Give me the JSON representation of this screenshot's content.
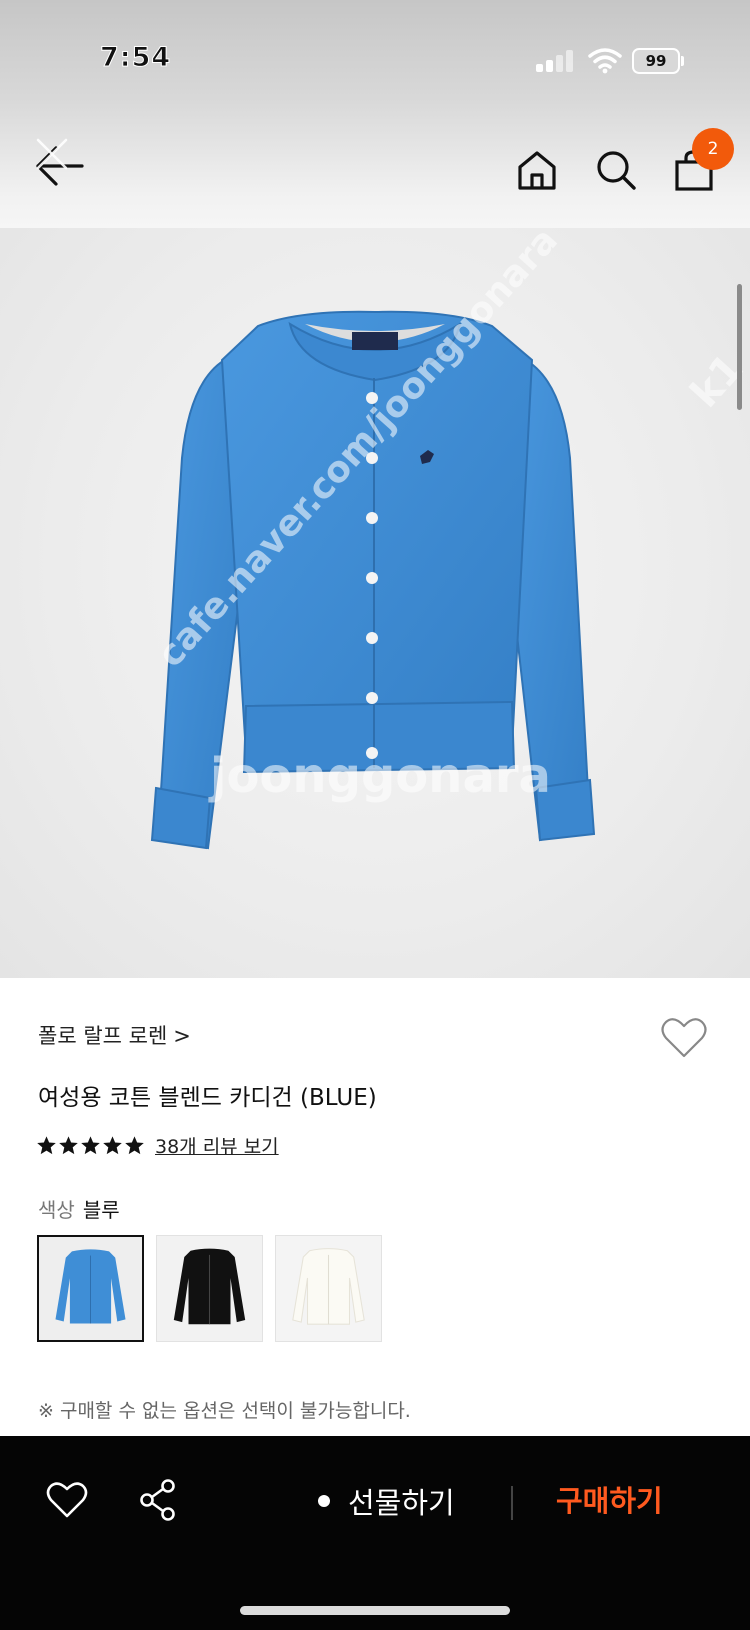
{
  "status_bar": {
    "time": "7:54",
    "battery": "99",
    "icons": [
      "signal-icon",
      "wifi-icon",
      "battery-icon"
    ]
  },
  "nav": {
    "icons": [
      "back-arrow-icon",
      "home-icon",
      "search-icon",
      "shopping-bag-icon"
    ],
    "cart_badge": "2"
  },
  "hero": {
    "watermarks": [
      "joonggonara",
      "cafe.naver.com/joonggonara",
      "k1"
    ],
    "garment_color": "#3f8ed6",
    "background": "#ececec"
  },
  "product": {
    "brand": "폴로 랄프 로렌",
    "brand_chevron": ">",
    "name": "여성용 코튼 블렌드 카디건 (BLUE)",
    "rating": 5,
    "rating_max": 5,
    "reviews_label": "38개 리뷰 보기",
    "color_label": "색상",
    "color_value": "블루",
    "swatches": [
      {
        "color": "#3f8ed6",
        "selected": true
      },
      {
        "color": "#111111",
        "selected": false
      },
      {
        "color": "#f7f5ef",
        "selected": false
      }
    ],
    "notice": "※ 구매할 수 없는 옵션은 선택이 불가능합니다."
  },
  "bottom_bar": {
    "gift_label": "선물하기",
    "buy_label": "구매하기",
    "icons": [
      "heart-icon",
      "share-icon"
    ],
    "accent": "#ff5a1f"
  }
}
